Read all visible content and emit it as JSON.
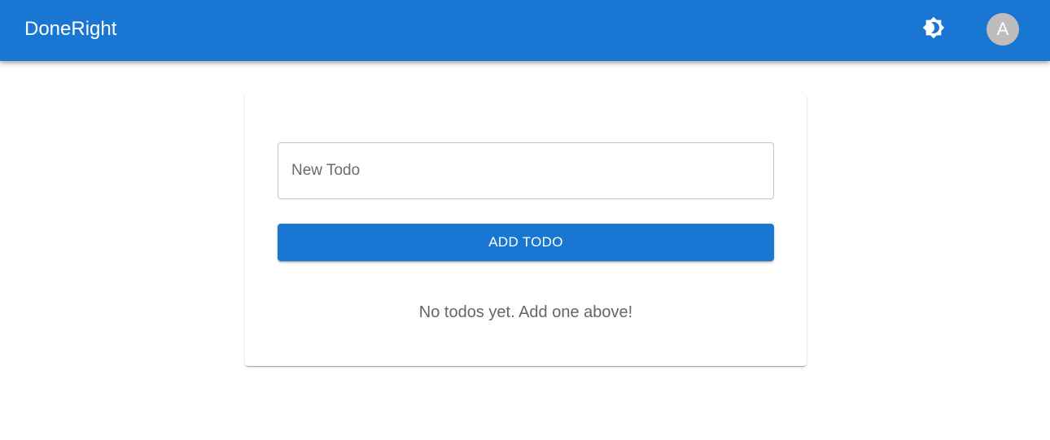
{
  "app_bar": {
    "title": "DoneRight",
    "theme_toggle_icon": "brightness-icon",
    "avatar_initial": "A",
    "background_color": "#1976d2"
  },
  "todo_form": {
    "input_placeholder": "New Todo",
    "input_value": "",
    "add_button_label": "ADD TODO"
  },
  "todo_list": {
    "empty_message": "No todos yet. Add one above!",
    "items": []
  }
}
